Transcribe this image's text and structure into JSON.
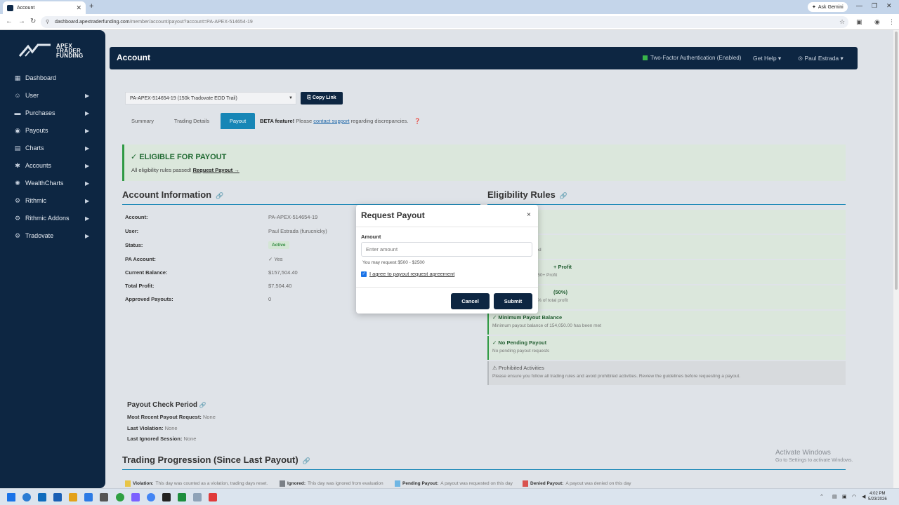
{
  "browser": {
    "tab_title": "Account",
    "gemini_label": "Ask Gemini",
    "url_host": "dashboard.apextraderfunding.com",
    "url_path": "/member/account/payout?account=PA-APEX-514654-19"
  },
  "logo": {
    "line1": "APEX",
    "line2": "TRADER",
    "line3": "FUNDING"
  },
  "sidebar": {
    "items": [
      {
        "label": "Dashboard",
        "icon": "grid-icon",
        "glyph": "▦",
        "arrow": false
      },
      {
        "label": "User",
        "icon": "user-icon",
        "glyph": "☺",
        "arrow": true
      },
      {
        "label": "Purchases",
        "icon": "cart-icon",
        "glyph": "▬",
        "arrow": true
      },
      {
        "label": "Payouts",
        "icon": "money-icon",
        "glyph": "◉",
        "arrow": true
      },
      {
        "label": "Charts",
        "icon": "chart-icon",
        "glyph": "▤",
        "arrow": true
      },
      {
        "label": "Accounts",
        "icon": "accounts-icon",
        "glyph": "✱",
        "arrow": true
      },
      {
        "label": "WealthCharts",
        "icon": "wealthcharts-icon",
        "glyph": "✺",
        "arrow": true
      },
      {
        "label": "Rithmic",
        "icon": "rithmic-icon",
        "glyph": "⚙",
        "arrow": true
      },
      {
        "label": "Rithmic Addons",
        "icon": "addons-icon",
        "glyph": "⚙",
        "arrow": true
      },
      {
        "label": "Tradovate",
        "icon": "tradovate-icon",
        "glyph": "⚙",
        "arrow": true
      }
    ]
  },
  "header": {
    "title": "Account",
    "two_factor": "Two-Factor Authentication (Enabled)",
    "help": "Get Help ▾",
    "user": "⊙ Paul Estrada ▾"
  },
  "account_select": {
    "value": "PA-APEX-514654-19 (150k Tradovate EOD Trail)",
    "copy_label": "⎘ Copy Link"
  },
  "tabs": [
    {
      "label": "Summary",
      "active": false
    },
    {
      "label": "Trading Details",
      "active": false
    },
    {
      "label": "Payout",
      "active": true
    }
  ],
  "beta": {
    "bold": "BETA feature!",
    "pre": " Please ",
    "link": "contact support",
    "post": " regarding discrepancies."
  },
  "eligible": {
    "title": "✓ ELIGIBLE FOR PAYOUT",
    "subtitle": "All eligibility rules passed!",
    "link": "Request Payout →"
  },
  "account_info": {
    "title": "Account Information",
    "rows": [
      {
        "label": "Account:",
        "value": "PA-APEX-514654-19"
      },
      {
        "label": "User:",
        "value": "Paul Estrada (furucnicky)"
      },
      {
        "label": "Status:",
        "value": "Active"
      },
      {
        "label": "PA Account:",
        "value": "✓ Yes"
      },
      {
        "label": "Current Balance:",
        "value": "$157,504.40"
      },
      {
        "label": "Total Profit:",
        "value": "$7,504.40"
      },
      {
        "label": "Approved Payouts:",
        "value": "0"
      }
    ]
  },
  "eligibility": {
    "title": "Eligibility Rules",
    "rules": [
      {
        "title": "",
        "sub": "e",
        "grey": false
      },
      {
        "title": "",
        "sub": "eted",
        "grey": false
      },
      {
        "title": "+ Profit",
        "sub": "$250+ Profit",
        "grey": false
      },
      {
        "title": "(50%)",
        "sub": "50% of total profit",
        "grey": false
      },
      {
        "title": "✓ Minimum Payout Balance",
        "sub": "Minimum payout balance of 154,050.00 has been met",
        "grey": false
      },
      {
        "title": "✓ No Pending Payout",
        "sub": "No pending payout requests",
        "grey": false
      },
      {
        "title": "⚠ Prohibited Activities",
        "sub": "Please ensure you follow all trading rules and avoid prohibited activities. Review the guidelines before requesting a payout.",
        "grey": true
      }
    ]
  },
  "payout_check": {
    "title": "Payout Check Period",
    "rows": [
      {
        "label": "Most Recent Payout Request:",
        "value": "None"
      },
      {
        "label": "Last Violation:",
        "value": "None"
      },
      {
        "label": "Last Ignored Session:",
        "value": "None"
      }
    ]
  },
  "trading_progression": {
    "title": "Trading Progression (Since Last Payout)"
  },
  "legend": [
    {
      "bold": "Violation:",
      "text": "This day was counted as a violation, trading days reset.",
      "color": "#e8c547"
    },
    {
      "bold": "Ignored:",
      "text": "This day was ignored from evaluation",
      "color": "#7a7f86"
    },
    {
      "bold": "Pending Payout:",
      "text": "A payout was requested on this day",
      "color": "#6fb6e3"
    },
    {
      "bold": "Denied Payout:",
      "text": "A payout was denied on this day",
      "color": "#d9534f"
    }
  ],
  "windows_activation": {
    "line1": "Activate Windows",
    "line2": "Go to Settings to activate Windows."
  },
  "modal": {
    "title": "Request Payout",
    "close": "×",
    "amount_label": "Amount",
    "amount_placeholder": "Enter amount",
    "hint": "You may request $500 - $2500",
    "agree_label": "I agree to payout request agreement",
    "cancel_label": "Cancel",
    "submit_label": "Submit"
  },
  "taskbar": {
    "time": "4:02 PM",
    "date": "5/23/2026"
  },
  "colors": {
    "navy": "#0d2642",
    "accent": "#1786b6",
    "success": "#2f9a44"
  }
}
